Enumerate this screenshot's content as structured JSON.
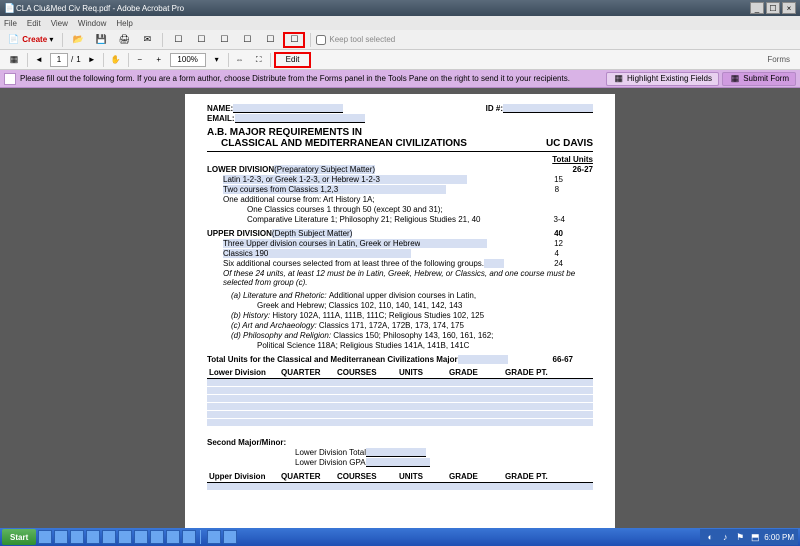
{
  "window": {
    "title": "CLA Clu&Med Civ Req.pdf - Adobe Acrobat Pro"
  },
  "menu": {
    "file": "File",
    "edit": "Edit",
    "view": "View",
    "window": "Window",
    "help": "Help"
  },
  "tb1": {
    "create": "Create",
    "keeptool": "Keep tool selected"
  },
  "tb2": {
    "page": "1",
    "pages": "1",
    "zoom": "100%",
    "edit": "Edit",
    "forms": "Forms"
  },
  "purple": {
    "msg": "Please fill out the following form. If you are a form author, choose Distribute from the Forms panel in the Tools Pane on the right to send it to your recipients.",
    "highlight": "Highlight Existing Fields",
    "submit": "Submit Form"
  },
  "doc": {
    "name_lbl": "NAME:",
    "id_lbl": "ID #:",
    "email_lbl": "EMAIL:",
    "h1a": "A.B. MAJOR REQUIREMENTS IN",
    "h1b": "CLASSICAL AND MEDITERRANEAN CIVILIZATIONS",
    "uc": "UC DAVIS",
    "tu": "Total Units",
    "tu_v": "26-27",
    "ld": "LOWER DIVISION",
    "ld_sub": " (Preparatory Subject Matter)",
    "ld1": "Latin 1-2-3, or Greek 1-2-3, or Hebrew 1-2-3",
    "ld1u": "15",
    "ld2": "Two courses from Classics 1,2,3",
    "ld2u": "8",
    "ld3": "One additional course from:  Art History 1A;",
    "ld3a": "One Classics courses 1 through 50 (except 30 and 31);",
    "ld3b": "Comparative Literature 1; Philosophy 21; Religious Studies 21, 40",
    "ld3u": "3-4",
    "ud": "UPPER DIVISION",
    "ud_sub": " (Depth Subject Matter)",
    "ud_u": "40",
    "ud1": "Three Upper division courses in Latin, Greek or Hebrew",
    "ud1u": "12",
    "ud2": "Classics 190",
    "ud2u": "4",
    "ud3": "Six additional courses selected from at least three of the following groups.",
    "ud3u": "24",
    "ud_note": "Of these 24 units, at least 12 must be in Latin, Greek, Hebrew, or Classics, and one course must be selected from group (c).",
    "ga": "(a)  Literature and Rhetoric:",
    "ga1": "Additional upper division courses in Latin,",
    "ga2": "Greek and Hebrew; Classics 102, 110, 140, 141, 142, 143",
    "gb": "(b)  History:",
    "gb1": "History 102A, 111A, 111B, 111C; Religious Studies 102, 125",
    "gc": "(c)  Art and Archaeology:",
    "gc1": "Classics 171, 172A, 172B, 173, 174, 175",
    "gd": "(d)  Philosophy and Religion:",
    "gd1": "Classics 150; Philosophy 143, 160, 161, 162;",
    "gd2": "Political Science 118A; Religious Studies 141A, 141B, 141C",
    "tot": "Total Units for the Classical and Mediterranean Civilizations Major",
    "tot_v": "66-67",
    "th_ld": "Lower Division",
    "th_q": "QUARTER",
    "th_c": "COURSES",
    "th_u": "UNITS",
    "th_g": "GRADE",
    "th_gp": "GRADE PT.",
    "sm": "Second Major/Minor:",
    "ldt": "Lower Division Total",
    "ldg": "Lower Division GPA",
    "th_ud": "Upper Division"
  },
  "task": {
    "start": "Start",
    "time": "6:00 PM"
  }
}
